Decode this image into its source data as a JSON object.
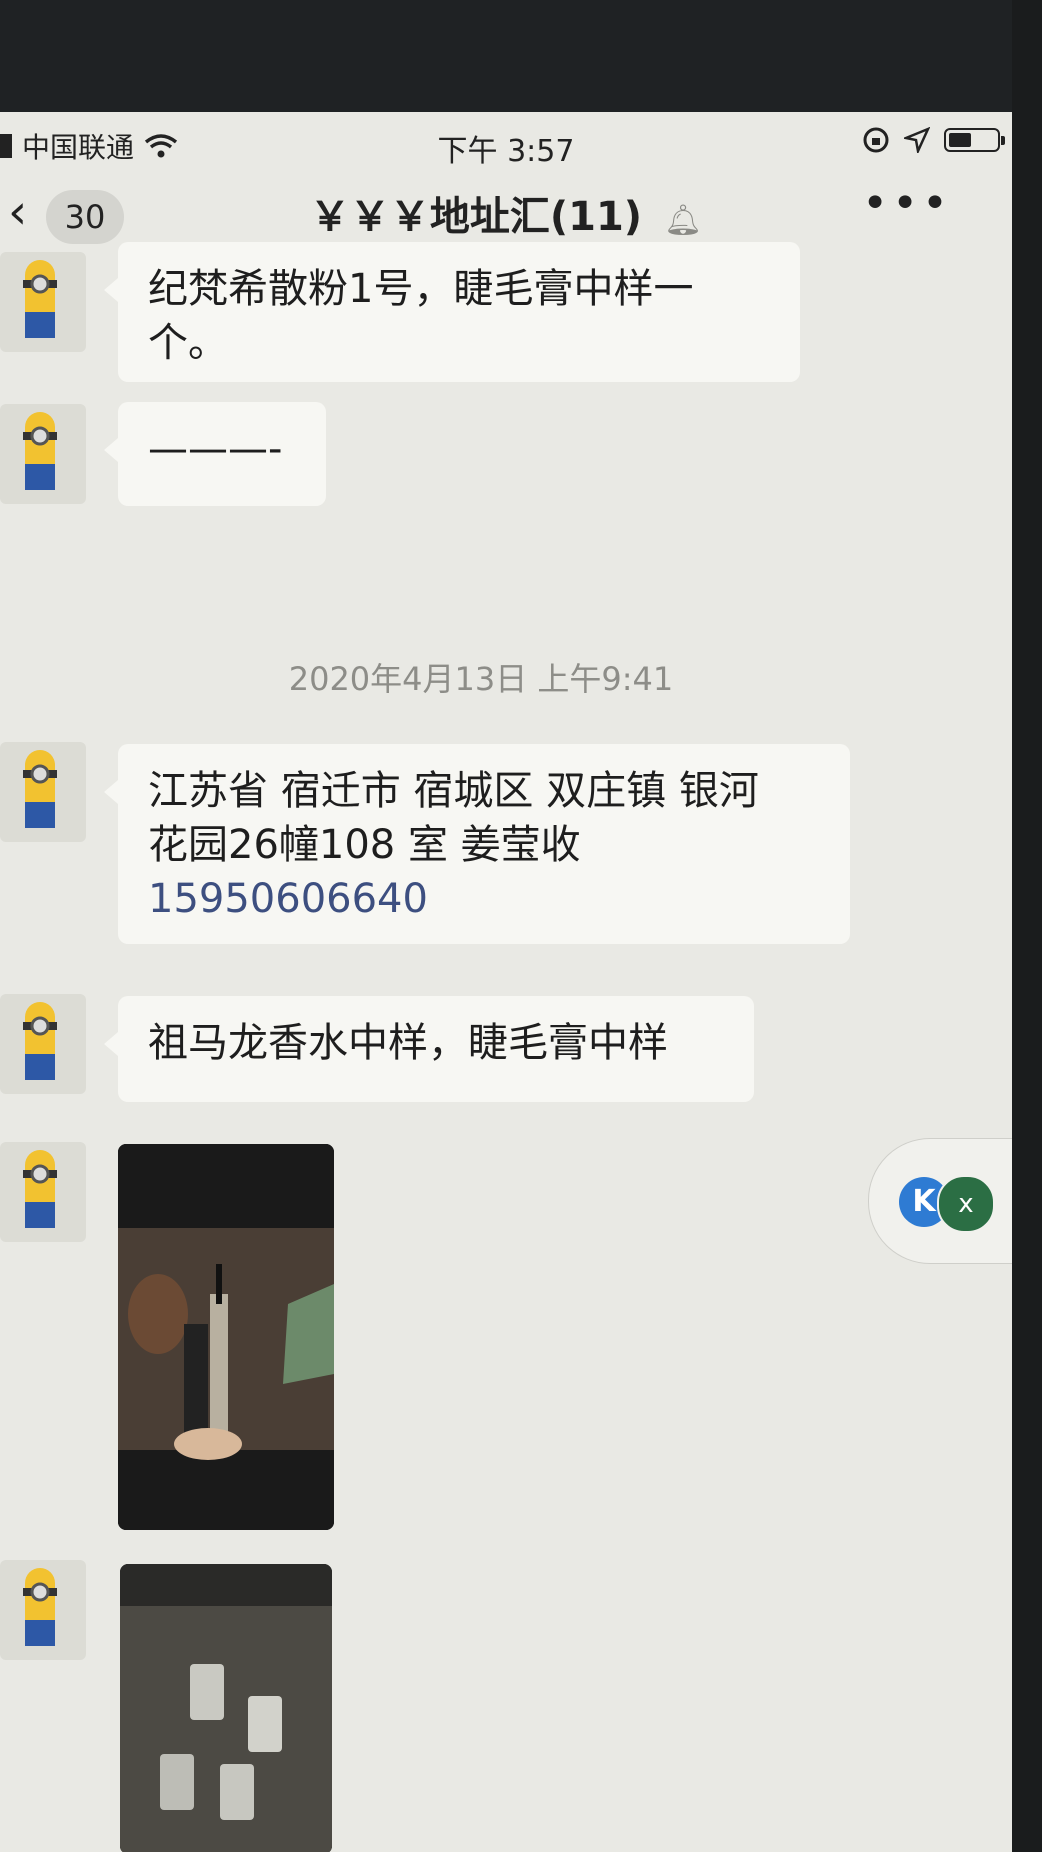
{
  "status_bar": {
    "carrier": "中国联通",
    "time": "下午 3:57"
  },
  "nav": {
    "back_count": "30",
    "title": "￥￥￥地址汇(11)",
    "more": "•••"
  },
  "messages": [
    {
      "type": "text",
      "text_line1": "纪梵希散粉1号，睫毛膏中样一",
      "text_line2": "个。"
    },
    {
      "type": "text",
      "text": "———-"
    },
    {
      "type": "timestamp",
      "text": "2020年4月13日 上午9:41"
    },
    {
      "type": "text",
      "text_line1": "江苏省 宿迁市 宿城区 双庄镇 银河",
      "text_line2": "花园26幢108 室 姜莹收",
      "phone": "15950606640"
    },
    {
      "type": "text",
      "text": "祖马龙香水中样，睫毛膏中样"
    },
    {
      "type": "image",
      "subject": "mascara-photo"
    },
    {
      "type": "image",
      "subject": "perfume-bottles-photo"
    }
  ],
  "floating": {
    "k_icon": "K",
    "close_icon": "x"
  }
}
